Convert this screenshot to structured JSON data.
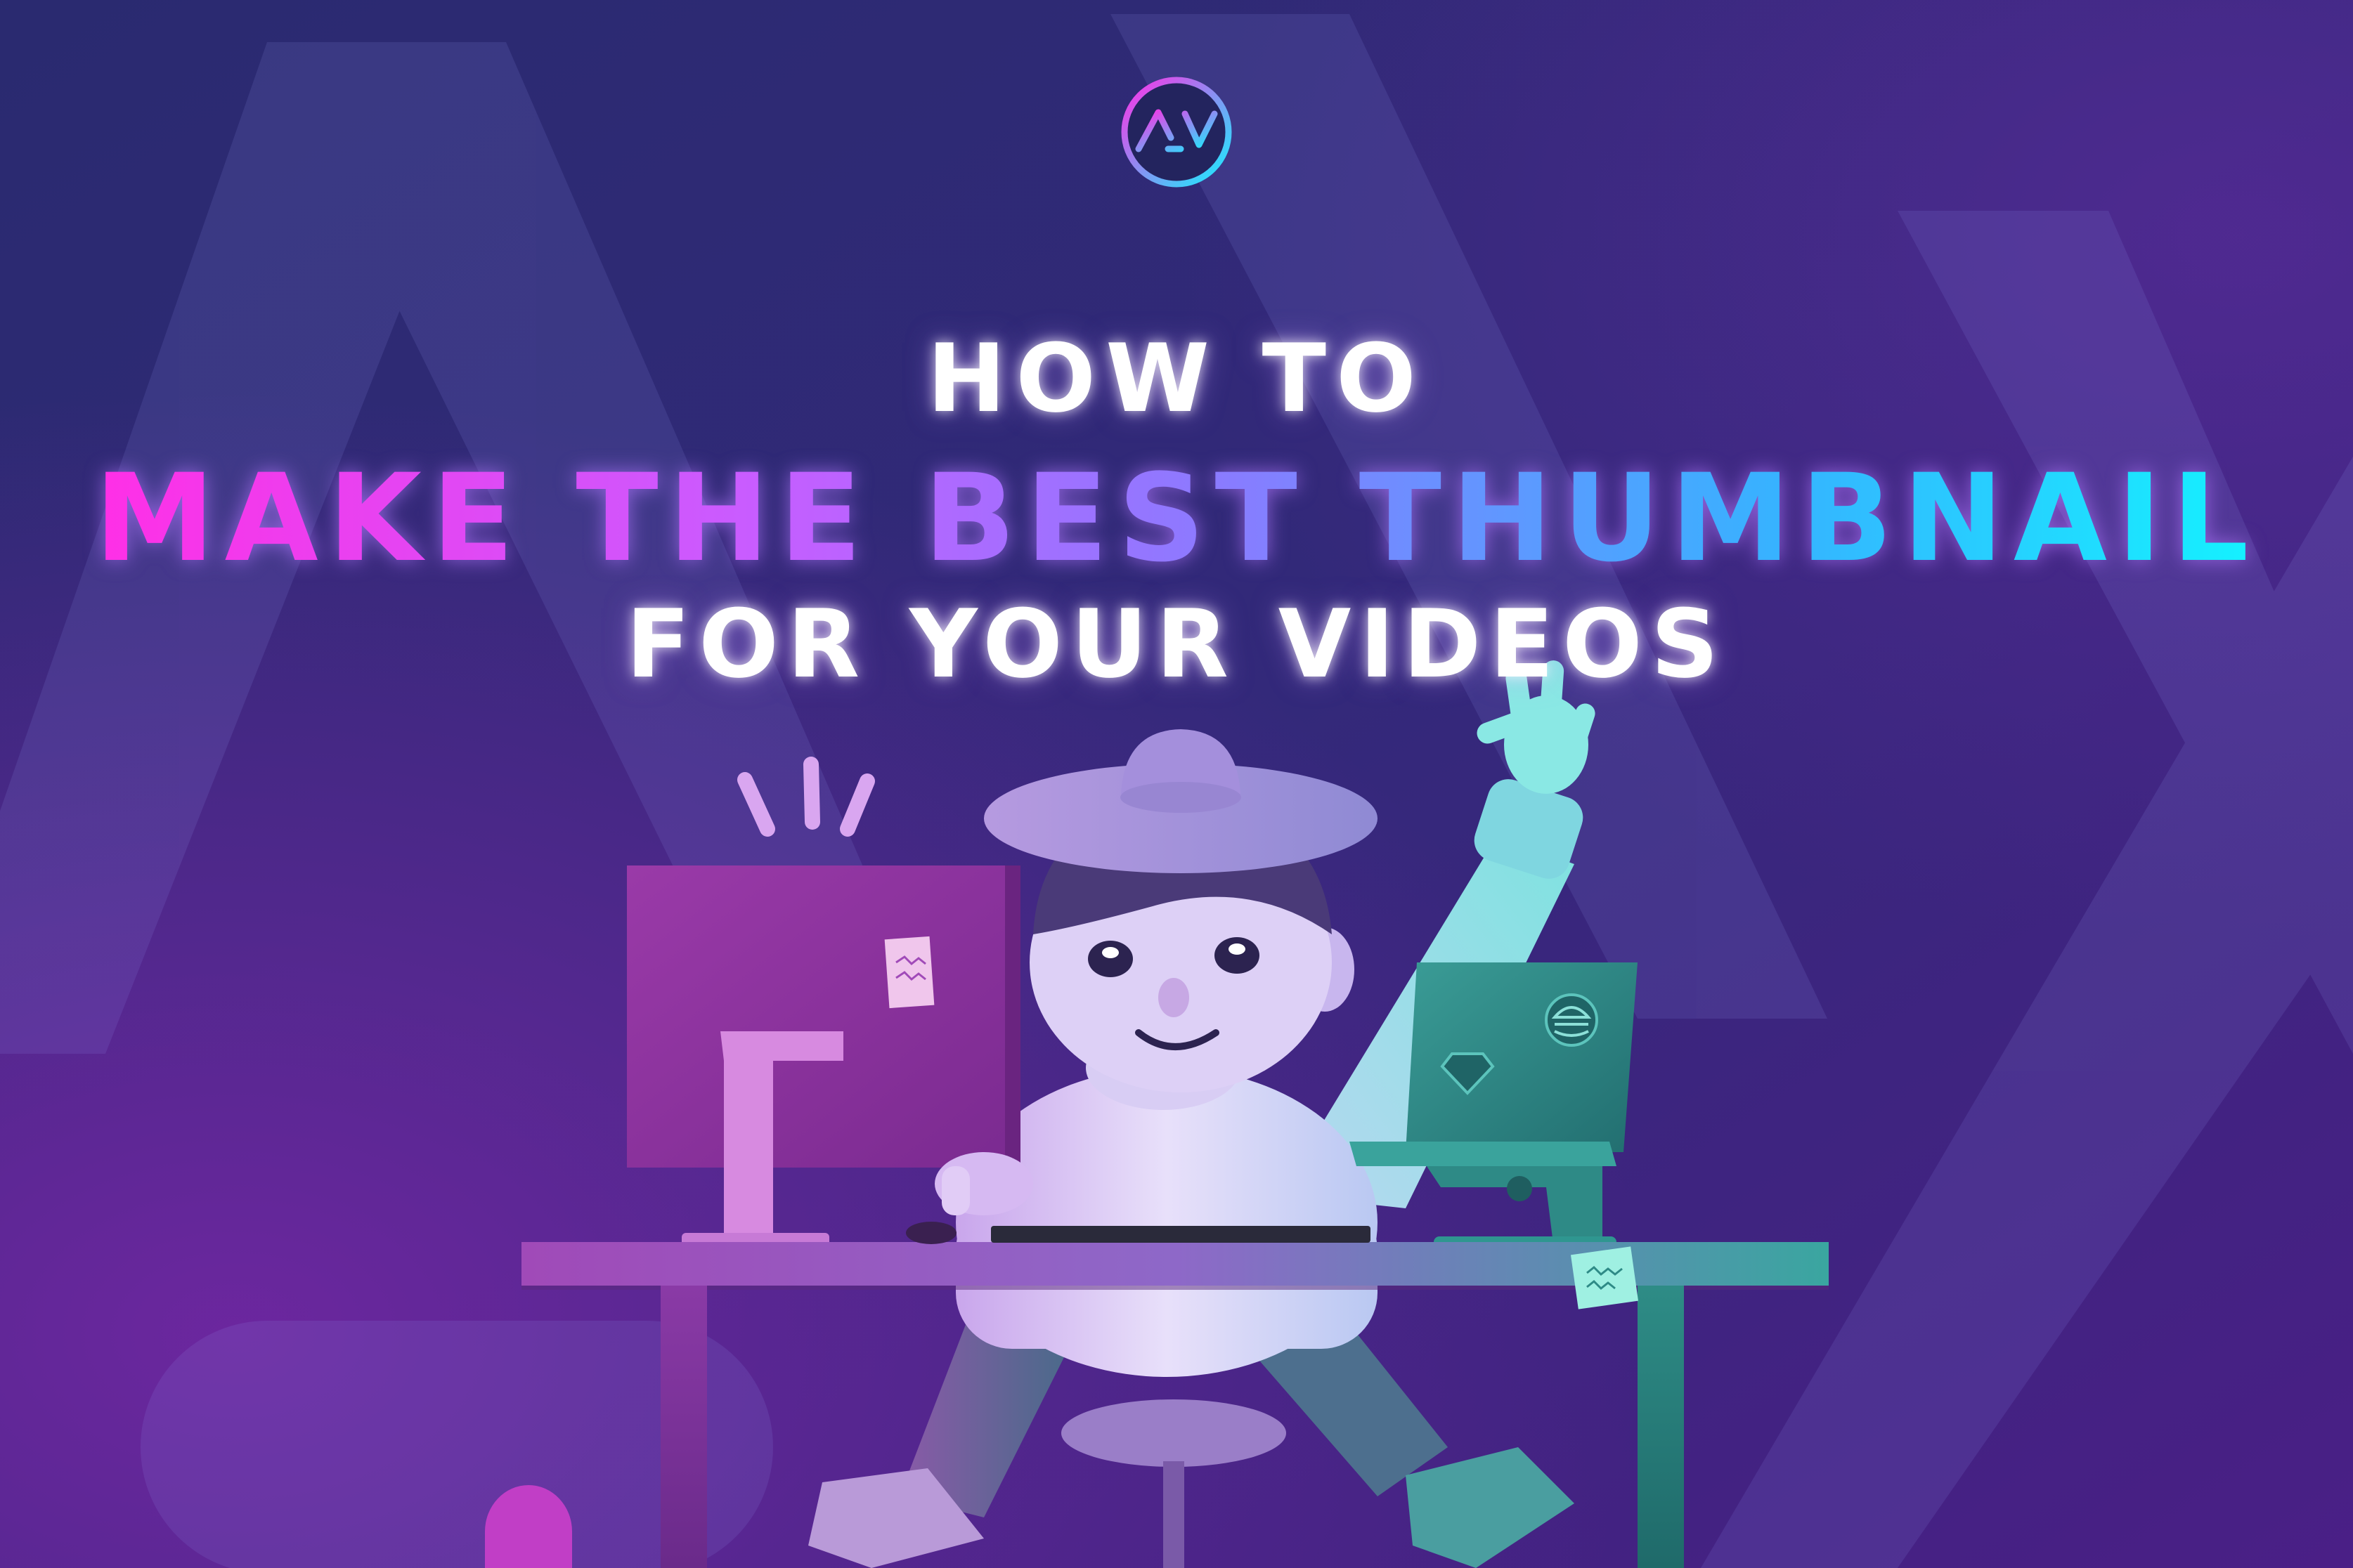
{
  "headline": {
    "line1": "HOW TO",
    "line2": "MAKE THE BEST THUMBNAIL",
    "line3": "FOR YOUR VIDEOS"
  },
  "logo": {
    "icon": "ay-logo-icon",
    "ring_gradient": [
      "#ff2fe6",
      "#14f2ff"
    ]
  },
  "colors": {
    "bg_dark": "#262a6b",
    "bg_purple": "#5b2396",
    "title_white": "#ffffff",
    "title_pink": "#ff2fe6",
    "title_cyan": "#14f2ff",
    "monitor": "#8e3aa0",
    "laptop": "#2e8c86"
  }
}
